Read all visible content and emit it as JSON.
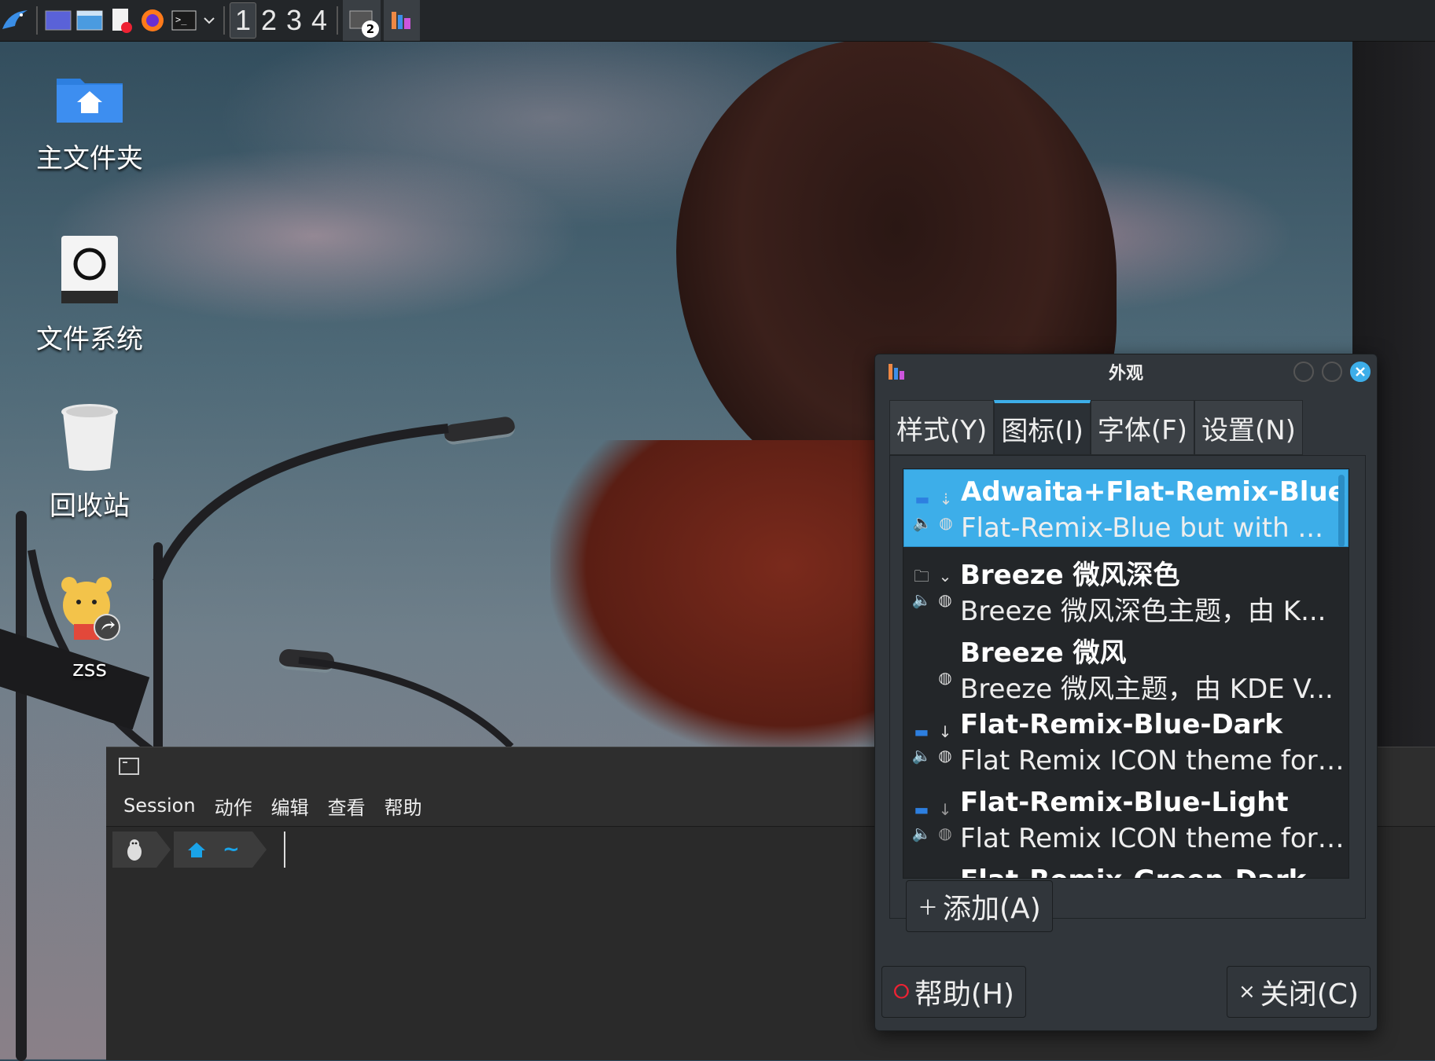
{
  "taskbar": {
    "desktops": [
      "1",
      "2",
      "3",
      "4"
    ],
    "active_desktop": "1",
    "task_badge": "2",
    "icons": [
      "kde-menu-icon",
      "desktop-icon",
      "file-manager-icon",
      "document-icon",
      "firefox-icon",
      "terminal-icon",
      "chevron-down-icon",
      "task-switcher-icon",
      "appearance-icon"
    ]
  },
  "desktop": {
    "icons": [
      {
        "label": "主文件夹",
        "icon": "home-folder-icon"
      },
      {
        "label": "文件系统",
        "icon": "drive-icon"
      },
      {
        "label": "回收站",
        "icon": "trash-icon"
      },
      {
        "label": "zss",
        "icon": "bear-shortcut-icon"
      }
    ]
  },
  "terminal": {
    "menu": [
      "Session",
      "动作",
      "编辑",
      "查看",
      "帮助"
    ],
    "prompt_dir": "~"
  },
  "dialog": {
    "title": "外观",
    "tabs": [
      "样式(Y)",
      "图标(I)",
      "字体(F)",
      "设置(N)"
    ],
    "active_tab": "图标(I)",
    "themes": [
      {
        "name": "Adwaita+Flat-Remix-Blue",
        "desc": "Flat-Remix-Blue but with ...",
        "selected": true
      },
      {
        "name": "Breeze 微风深色",
        "desc": "Breeze 微风深色主题，由 K..."
      },
      {
        "name": "Breeze 微风",
        "desc": "Breeze 微风主题，由 KDE V..."
      },
      {
        "name": "Flat-Remix-Blue-Dark",
        "desc": "Flat Remix ICON theme for ..."
      },
      {
        "name": "Flat-Remix-Blue-Light",
        "desc": "Flat Remix ICON theme for l..."
      },
      {
        "name": "Flat-Remix-Green-Dark",
        "desc": ""
      }
    ],
    "add_button": "添加(A)",
    "help_button": "帮助(H)",
    "close_button": "关闭(C)"
  },
  "colors": {
    "accent": "#3daee9",
    "dialog_bg": "#31363b",
    "list_bg": "#232629",
    "taskbar_bg": "#232629"
  }
}
